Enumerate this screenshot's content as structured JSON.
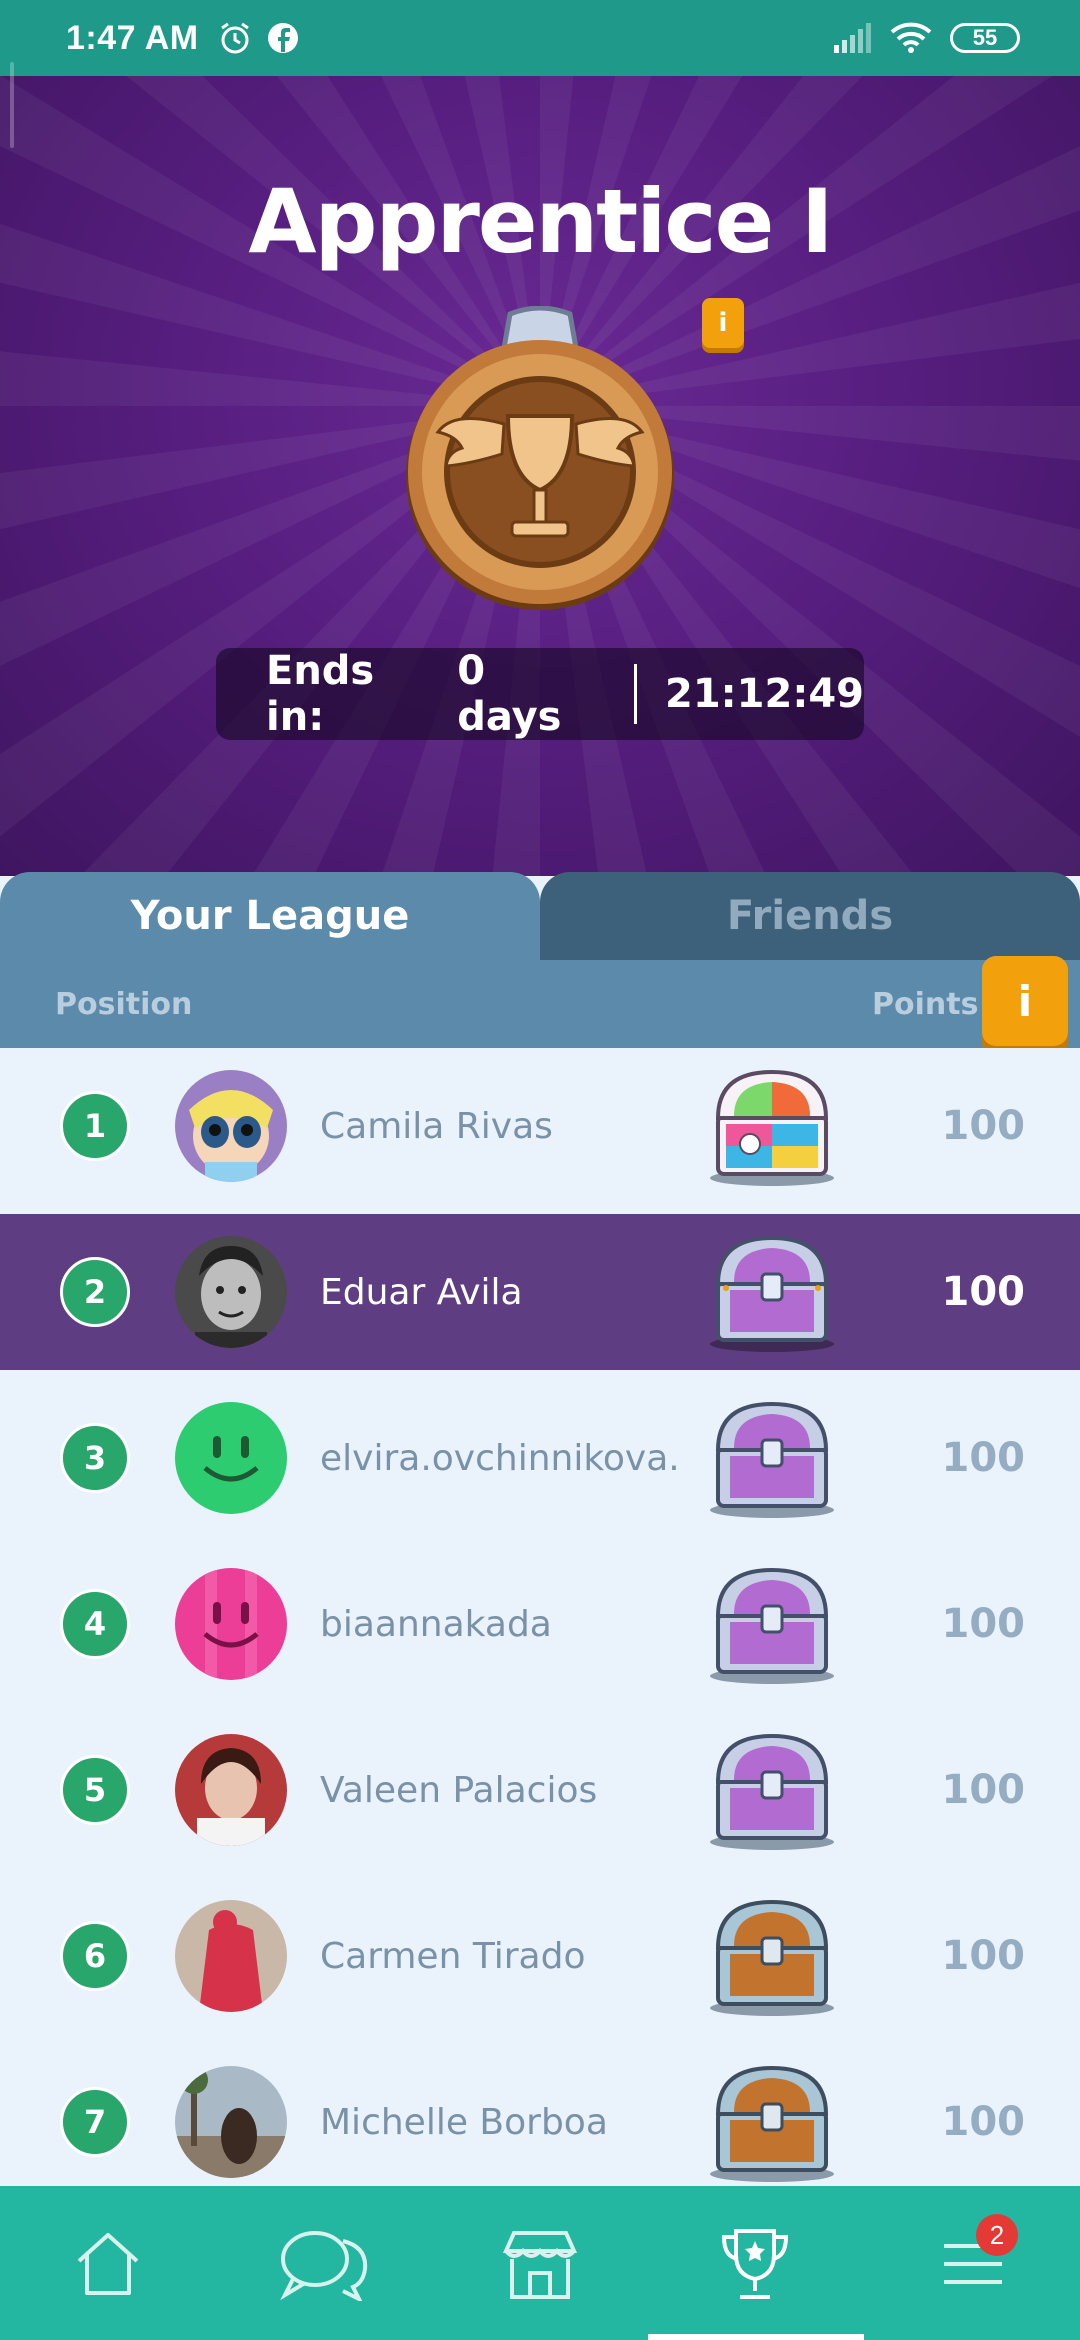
{
  "status_bar": {
    "time": "1:47 AM",
    "battery": "55"
  },
  "header": {
    "league_title": "Apprentice I",
    "info_label": "i",
    "timer": {
      "ends_label": "Ends in:",
      "days": "0 days",
      "time": "21:12:49"
    }
  },
  "tabs": [
    {
      "label": "Your League",
      "active": true
    },
    {
      "label": "Friends",
      "active": false
    }
  ],
  "table": {
    "position_header": "Position",
    "points_header": "Points",
    "info_label": "i",
    "rows": [
      {
        "position": "1",
        "name": "Camila Rivas",
        "points": "100",
        "chest": "rainbow",
        "avatar": "cartoon"
      },
      {
        "position": "2",
        "name": "Eduar Avila",
        "points": "100",
        "chest": "purple",
        "avatar": "photo-bw",
        "highlighted": true
      },
      {
        "position": "3",
        "name": "elvira.ovchinnikova.",
        "points": "100",
        "chest": "purple",
        "avatar": "green-smiley"
      },
      {
        "position": "4",
        "name": "biaannakada",
        "points": "100",
        "chest": "purple",
        "avatar": "pink-smiley"
      },
      {
        "position": "5",
        "name": "Valeen Palacios",
        "points": "100",
        "chest": "purple",
        "avatar": "photo"
      },
      {
        "position": "6",
        "name": "Carmen Tirado",
        "points": "100",
        "chest": "wood",
        "avatar": "photo"
      },
      {
        "position": "7",
        "name": "Michelle Borboa",
        "points": "100",
        "chest": "wood",
        "avatar": "photo"
      }
    ]
  },
  "bottom_nav": {
    "items": [
      "home-icon",
      "chat-icon",
      "shop-icon",
      "trophy-icon",
      "menu-icon"
    ],
    "menu_badge": "2",
    "active": "trophy-icon"
  },
  "colors": {
    "accent_teal": "#23b6a0",
    "purple": "#571e80",
    "orange": "#f2a10d",
    "green": "#28a66b"
  }
}
